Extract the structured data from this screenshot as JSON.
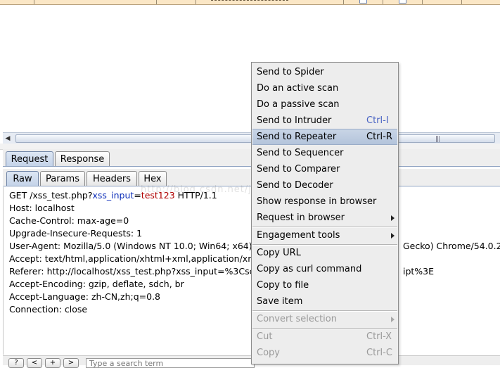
{
  "response_tabs": [
    {
      "label": "Request"
    },
    {
      "label": "Response"
    }
  ],
  "view_tabs": [
    {
      "label": "Raw"
    },
    {
      "label": "Params"
    },
    {
      "label": "Headers"
    },
    {
      "label": "Hex"
    }
  ],
  "request": {
    "line1": {
      "method": "GET /xss_test.php?",
      "param": "xss_input",
      "eq": "=",
      "value": "test123",
      "protocol": " HTTP/1.1"
    },
    "host": "Host: localhost",
    "cache_control": "Cache-Control: max-age=0",
    "upgrade": "Upgrade-Insecure-Requests: 1",
    "user_agent_start": "User-Agent: Mozilla/5.0 (Windows NT 10.0; Win64; x64)",
    "user_agent_end": "Gecko) Chrome/54.0.2",
    "accept": "Accept: text/html,application/xhtml+xml,application/xm",
    "referer_start": "Referer: http://localhost/xss_test.php?xss_input=%3Cscr",
    "referer_end": "ipt%3E",
    "accept_encoding": "Accept-Encoding: gzip, deflate, sdch, br",
    "accept_language": "Accept-Language: zh-CN,zh;q=0.8",
    "connection": "Connection: close"
  },
  "watermark": "http://blog.csdn.net/jiangzhexi",
  "search": {
    "help_label": "?",
    "prev_label": "<",
    "next_label": "+",
    "forward_label": ">",
    "placeholder": "Type a search term"
  },
  "context_menu": {
    "items": [
      {
        "label": "Send to Spider"
      },
      {
        "label": "Do an active scan"
      },
      {
        "label": "Do a passive scan"
      },
      {
        "label": "Send to Intruder",
        "shortcut": "Ctrl-I"
      },
      {
        "label": "Send to Repeater",
        "shortcut": "Ctrl-R"
      },
      {
        "label": "Send to Sequencer"
      },
      {
        "label": "Send to Comparer"
      },
      {
        "label": "Send to Decoder"
      },
      {
        "label": "Show response in browser"
      },
      {
        "label": "Request in browser"
      },
      {
        "label": "Engagement tools"
      },
      {
        "label": "Copy URL"
      },
      {
        "label": "Copy as curl command"
      },
      {
        "label": "Copy to file"
      },
      {
        "label": "Save item"
      },
      {
        "label": "Convert selection"
      },
      {
        "label": "Cut",
        "shortcut": "Ctrl-X"
      },
      {
        "label": "Copy",
        "shortcut": "Ctrl-C"
      }
    ]
  },
  "colors": {
    "menu_highlight": "#b4c4db",
    "param_name": "#0b2db8",
    "param_value": "#b00000",
    "header_row": "#fbe7c6"
  }
}
